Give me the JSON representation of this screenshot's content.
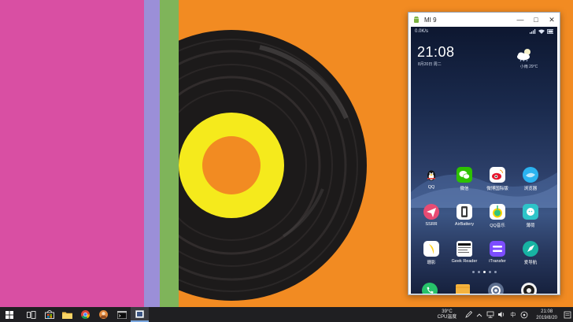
{
  "window": {
    "title": "MI 9",
    "minimize_icon": "minimize-icon",
    "maximize_icon": "maximize-icon",
    "close_icon": "close-icon",
    "app_icon": "android-icon"
  },
  "phone": {
    "status_bar": {
      "net_speed": "0.0K/s",
      "icons": [
        "signal-icon",
        "wifi-icon",
        "battery-icon"
      ]
    },
    "clock": {
      "time": "21:08",
      "date": "8月20日 周二"
    },
    "weather": {
      "icon": "cloud-moon-icon",
      "text": "小雨  29°C"
    },
    "apps": [
      {
        "label": "QQ",
        "icon": "qq-penguin-icon",
        "color": "#ffffff"
      },
      {
        "label": "微信",
        "icon": "wechat-icon",
        "color": "#2dc100"
      },
      {
        "label": "微博国际版",
        "icon": "weibo-icon",
        "color": "#ffffff"
      },
      {
        "label": "浏览器",
        "icon": "browser-icon",
        "color": "#2bb3f0"
      },
      {
        "label": "SSRR",
        "icon": "paper-plane-icon",
        "color": "#e84b73"
      },
      {
        "label": "AirBattery",
        "icon": "airbattery-icon",
        "color": "#ffffff"
      },
      {
        "label": "QQ音乐",
        "icon": "qq-music-icon",
        "color": "#ffffff"
      },
      {
        "label": "薄荷",
        "icon": "bohe-icon",
        "color": "#2ec4c9"
      },
      {
        "label": "珊影",
        "icon": "banana-icon",
        "color": "#ffffff"
      },
      {
        "label": "Geek Reader",
        "icon": "geek-reader-icon",
        "color": "#ffffff"
      },
      {
        "label": "iTransfer",
        "icon": "itransfer-icon",
        "color": "#7c4dff"
      },
      {
        "label": "爱导航",
        "icon": "compass-icon",
        "color": "#17b3a3"
      }
    ],
    "page_indicator": {
      "count": 5,
      "active": 2
    },
    "dock": [
      {
        "icon": "phone-icon",
        "color": "#27c26a"
      },
      {
        "icon": "notes-icon",
        "color": "#f4b33e"
      },
      {
        "icon": "settings-icon",
        "color": "#5d6f8f"
      },
      {
        "icon": "camera-icon",
        "color": "#1c1c1c"
      }
    ]
  },
  "taskbar": {
    "items": [
      {
        "icon": "windows-start-icon"
      },
      {
        "icon": "task-view-icon"
      },
      {
        "icon": "store-icon"
      },
      {
        "icon": "file-explorer-icon"
      },
      {
        "icon": "chrome-icon"
      },
      {
        "icon": "avatar-app-icon"
      },
      {
        "icon": "terminal-icon"
      },
      {
        "icon": "scrcpy-window-icon"
      }
    ],
    "cpu_temp_value": "39°C",
    "cpu_temp_label": "CPU温度",
    "tray_icons": [
      "pen-icon",
      "chevron-up-icon",
      "network-icon",
      "volume-icon"
    ],
    "ime": "中",
    "tray_extra_icon": "ime-mode-icon",
    "clock_time": "21:08",
    "clock_date": "2019/8/20",
    "notification_icon": "notification-icon"
  },
  "colors": {
    "wallpaper_orange": "#f28b22",
    "wallpaper_pink": "#d94fa3",
    "record_label": "#f5ea1c",
    "taskbar": "#1f1f22"
  }
}
